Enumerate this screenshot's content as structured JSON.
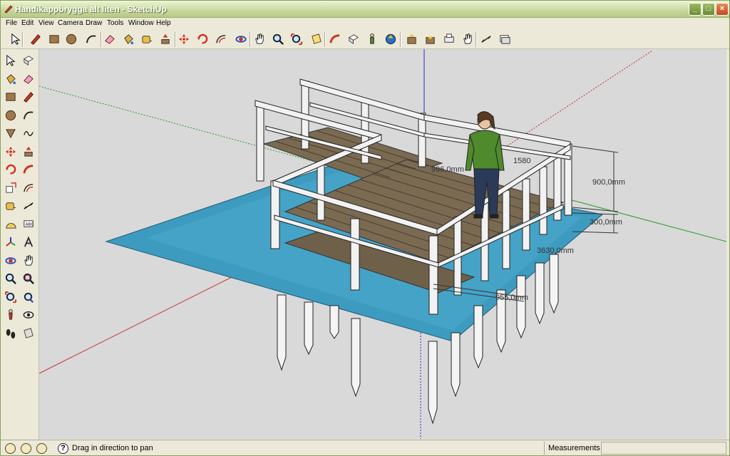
{
  "window": {
    "title": "Handikappbrygga alt liten - SketchUp",
    "min_label": "_",
    "max_label": "□",
    "close_label": "×"
  },
  "menu": {
    "items": [
      "File",
      "Edit",
      "View",
      "Camera",
      "Draw",
      "Tools",
      "Window",
      "Help"
    ]
  },
  "toolbar_top": {
    "icons": [
      "select-icon",
      "pencil-icon",
      "rectangle-icon",
      "circle-icon",
      "arc-icon",
      "eraser-icon",
      "paint-bucket-icon",
      "tape-measure-icon",
      "push-pull-icon",
      "move-icon",
      "rotate-icon",
      "offset-icon",
      "orbit-icon",
      "pan-icon",
      "zoom-icon",
      "zoom-extents-icon",
      "section-plane-icon",
      "follow-me-icon",
      "component-icon",
      "person-icon",
      "upload-icon",
      "import-icon",
      "export-icon",
      "print-icon",
      "hand-icon",
      "dimension-icon",
      "layers-icon"
    ]
  },
  "toolbar_left": {
    "icons": [
      "select-icon",
      "make-component-icon",
      "paint-bucket-icon",
      "eraser-icon",
      "rectangle-icon",
      "line-icon",
      "circle-icon",
      "arc-icon",
      "polygon-icon",
      "freehand-icon",
      "move-icon",
      "push-pull-icon",
      "rotate-icon",
      "follow-me-icon",
      "scale-icon",
      "offset-icon",
      "tape-measure-icon",
      "dimension-icon",
      "protractor-icon",
      "text-icon",
      "axes-icon",
      "3d-text-icon",
      "orbit-icon",
      "pan-icon",
      "zoom-icon",
      "zoom-window-icon",
      "zoom-extents-icon",
      "previous-view-icon",
      "position-camera-icon",
      "look-around-icon",
      "walk-icon",
      "section-icon"
    ]
  },
  "viewport": {
    "dimensions": [
      "996,0mm",
      "1580",
      "900,0mm",
      "300,0mm",
      "3630,0mm",
      "955,0mm"
    ],
    "colors": {
      "background": "#d9d9d9",
      "water": "#3e9bc0",
      "deck": "#7a6a52",
      "rail": "#f2f2f2",
      "person_shirt": "#4f8a2c",
      "person_pants": "#2c3a5a",
      "axis_red": "#c82a2a",
      "axis_green": "#2a9c2a",
      "axis_blue": "#2a2acc"
    }
  },
  "status": {
    "text": "Drag in direction to pan",
    "measurements_label": "Measurements",
    "measurements_value": "",
    "help_label": "?"
  }
}
